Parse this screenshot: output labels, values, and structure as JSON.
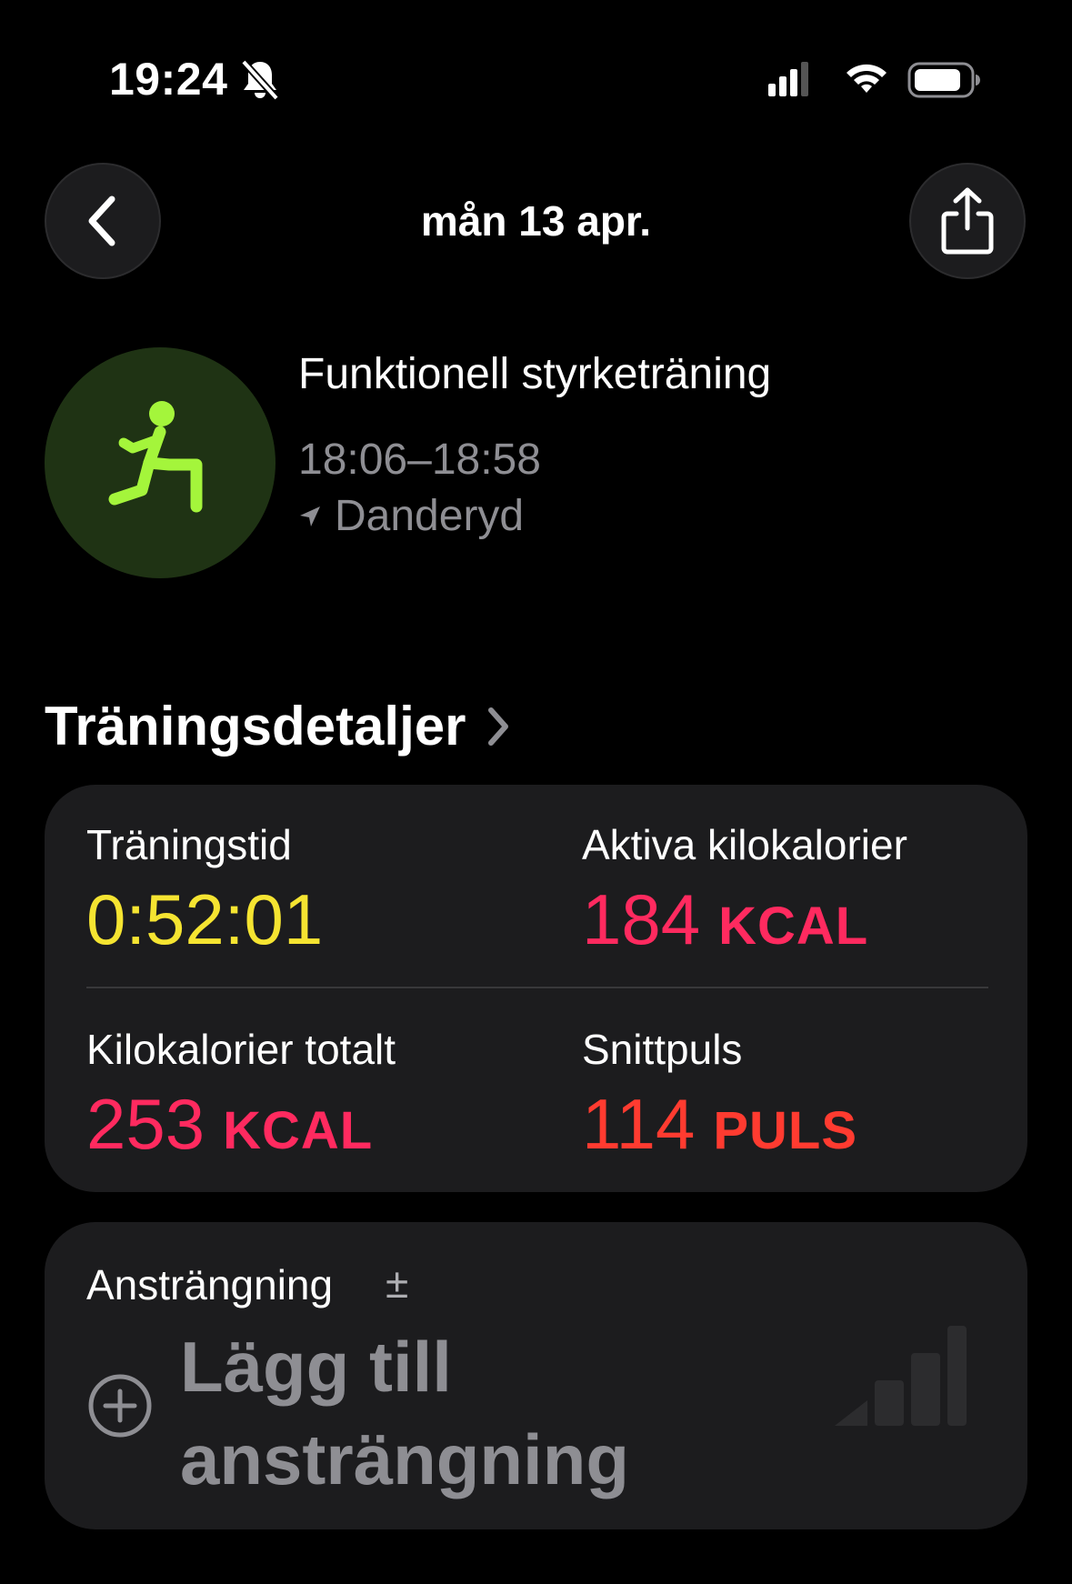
{
  "status_bar": {
    "time": "19:24",
    "icons": [
      "bell-slash-icon",
      "cellular-signal-icon",
      "wifi-icon",
      "battery-icon"
    ]
  },
  "nav": {
    "title": "mån 13 apr.",
    "back_icon": "chevron-left-icon",
    "share_icon": "share-icon"
  },
  "workout": {
    "icon": "functional-strength-icon",
    "name": "Funktionell styrketräning",
    "time_range": "18:06–18:58",
    "location": "Danderyd"
  },
  "section": {
    "title": "Träningsdetaljer"
  },
  "metrics": [
    {
      "label": "Träningstid",
      "value": "0:52:01",
      "unit": ""
    },
    {
      "label": "Aktiva kilokalorier",
      "value": "184",
      "unit": "KCAL"
    },
    {
      "label": "Kilokalorier totalt",
      "value": "253",
      "unit": "KCAL"
    },
    {
      "label": "Snittpuls",
      "value": "114",
      "unit": "PULS"
    }
  ],
  "effort": {
    "label": "Ansträngning",
    "symbol": "±",
    "add_line1": "Lägg till",
    "add_line2": "ansträngning"
  },
  "colors": {
    "duration": "#f5e431",
    "calories": "#ff2a5f",
    "heart_rate": "#ff3b30",
    "workout_icon": "#a4f53b"
  }
}
